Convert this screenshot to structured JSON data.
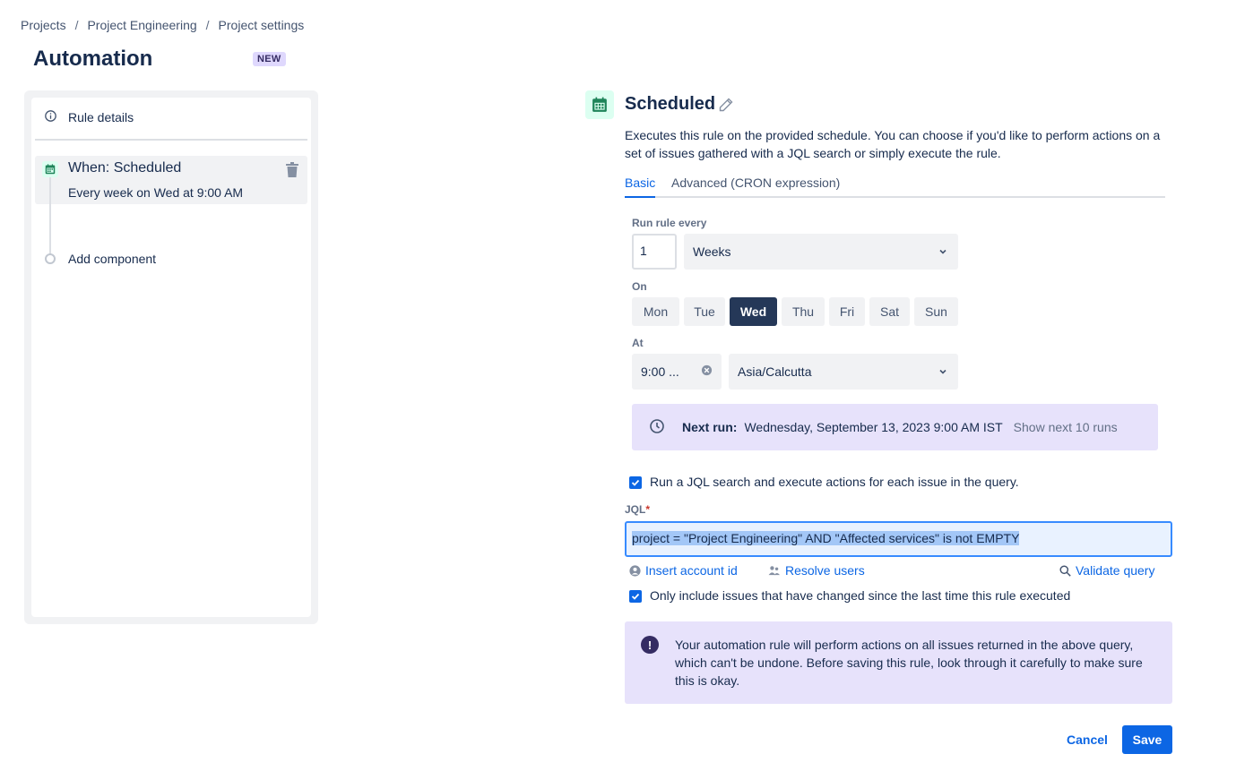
{
  "breadcrumb": {
    "items": [
      "Projects",
      "Project Engineering",
      "Project settings"
    ],
    "separator": "/"
  },
  "page": {
    "title": "Automation",
    "badge": "NEW"
  },
  "sidebar": {
    "rule_details_label": "Rule details",
    "trigger": {
      "title": "When: Scheduled",
      "subtitle": "Every week on Wed at 9:00 AM"
    },
    "add_component_label": "Add component"
  },
  "main": {
    "title": "Scheduled",
    "description": "Executes this rule on the provided schedule. You can choose if you'd like to perform actions on a set of issues gathered with a JQL search or simply execute the rule.",
    "tabs": [
      {
        "label": "Basic",
        "active": true
      },
      {
        "label": "Advanced (CRON expression)",
        "active": false
      }
    ],
    "run_every": {
      "label": "Run rule every",
      "value": "1",
      "unit": "Weeks"
    },
    "on": {
      "label": "On",
      "days": [
        "Mon",
        "Tue",
        "Wed",
        "Thu",
        "Fri",
        "Sat",
        "Sun"
      ],
      "selected": "Wed"
    },
    "at": {
      "label": "At",
      "time": "9:00 ...",
      "timezone": "Asia/Calcutta"
    },
    "next_run": {
      "label": "Next run:",
      "value": "Wednesday, September 13, 2023 9:00 AM IST",
      "link": "Show next 10 runs"
    },
    "jql_checkbox": {
      "checked": true,
      "label": "Run a JQL search and execute actions for each issue in the query."
    },
    "jql": {
      "label": "JQL",
      "required_marker": "*",
      "value": "project = \"Project Engineering\" AND \"Affected services\" is not EMPTY"
    },
    "helpers": {
      "insert_account": "Insert account id",
      "resolve_users": "Resolve users",
      "validate_query": "Validate query"
    },
    "changed_checkbox": {
      "checked": true,
      "label": "Only include issues that have changed since the last time this rule executed"
    },
    "warning": {
      "icon": "!",
      "text": "Your automation rule will perform actions on all issues returned in the above query, which can't be undone. Before saving this rule, look through it carefully to make sure this is okay."
    },
    "buttons": {
      "cancel": "Cancel",
      "save": "Save"
    }
  },
  "colors": {
    "accent": "#0c66e4",
    "selected_day": "#253858",
    "info_bg": "#e7e2fb"
  }
}
